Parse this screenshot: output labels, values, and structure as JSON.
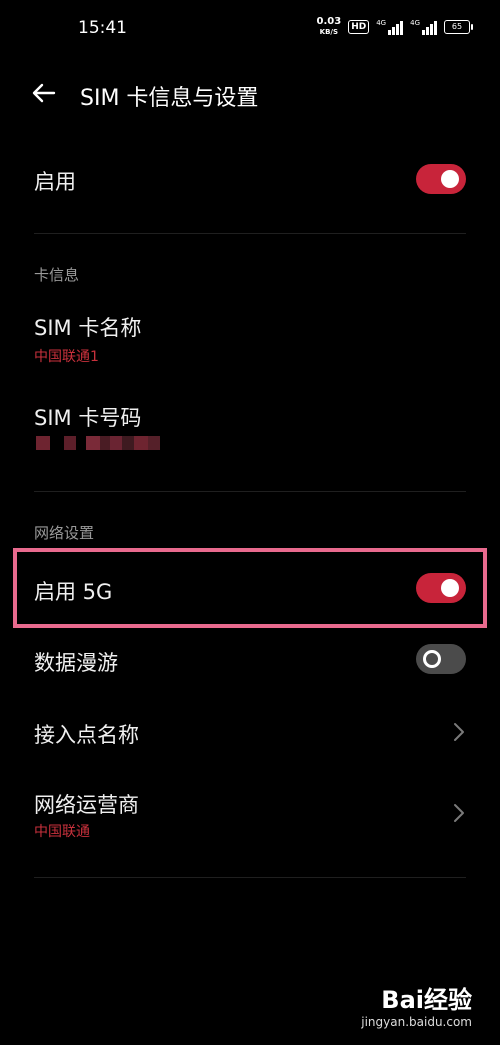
{
  "status_bar": {
    "time": "15:41",
    "speed_value": "0.03",
    "speed_unit": "KB/S",
    "hd_label": "HD",
    "network_gen_1": "4G",
    "network_gen_2": "4G",
    "battery": "65"
  },
  "header": {
    "title": "SIM 卡信息与设置"
  },
  "enable": {
    "label": "启用",
    "enabled": true
  },
  "card_info": {
    "section_title": "卡信息",
    "sim_name_label": "SIM 卡名称",
    "sim_name_value": "中国联通1",
    "sim_number_label": "SIM 卡号码"
  },
  "network": {
    "section_title": "网络设置",
    "enable_5g_label": "启用 5G",
    "enable_5g": true,
    "data_roaming_label": "数据漫游",
    "data_roaming": false,
    "apn_label": "接入点名称",
    "carrier_label": "网络运营商",
    "carrier_value": "中国联通"
  },
  "watermark": {
    "brand": "Bai经验",
    "url": "jingyan.baidu.com"
  },
  "colors": {
    "accent": "#c8243a",
    "highlight_border": "#e86a8e",
    "subtext_red": "#c8313c"
  }
}
